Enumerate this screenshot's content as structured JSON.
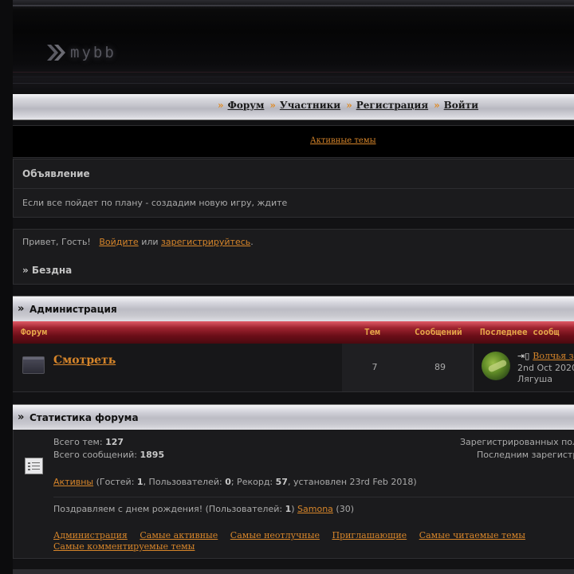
{
  "header": {
    "logo_text": "mybb"
  },
  "nav": {
    "separator": "»",
    "items": [
      "Форум",
      "Участники",
      "Регистрация",
      "Войти"
    ]
  },
  "active_topics_link": "Активные темы",
  "announcement": {
    "title": "Объявление",
    "text": "Если все пойдет по плану - создадим новую игру, ждите"
  },
  "welcome": {
    "greeting": "Привет, Гость!",
    "login_link": "Войдите",
    "or": "или",
    "register_link": "зарегистрируйтесь",
    "period": ".",
    "breadcrumb": "» Бездна"
  },
  "category": {
    "title": "Администрация",
    "columns": {
      "forum": "Форум",
      "topics": "Тем",
      "posts": "Сообщений",
      "last": "Последнее сообщ"
    },
    "forums": [
      {
        "name": "Смотреть",
        "topics": "7",
        "posts": "89",
        "last_post_title": "Волчья з",
        "last_post_date": "2nd Oct 2020",
        "last_post_user": "Лягуша"
      }
    ]
  },
  "stats": {
    "title": "Статистика форума",
    "total_topics_label": "Всего тем:",
    "total_topics": "127",
    "total_posts_label": "Всего сообщений:",
    "total_posts": "1895",
    "registered_label": "Зарегистрированных пол",
    "last_registered_label": "Последним зарегистр",
    "active_link": "Активны",
    "guests_label": "(Гостей:",
    "guests": "1",
    "users_label": ", Пользователей:",
    "users": "0",
    "record_label": "; Рекорд:",
    "record": "57",
    "record_date": ", установлен 23rd Feb 2018)",
    "birthday_text": "Поздравляем с днем рождения! (Пользователей:",
    "birthday_count": "1",
    "birthday_close": ")",
    "birthday_user": "Samona",
    "birthday_age": "(30)",
    "links": [
      "Администрация",
      "Самые активные",
      "Самые неотлучные",
      "Приглашающие",
      "Самые читаемые темы",
      "Самые комментируемые темы"
    ]
  }
}
